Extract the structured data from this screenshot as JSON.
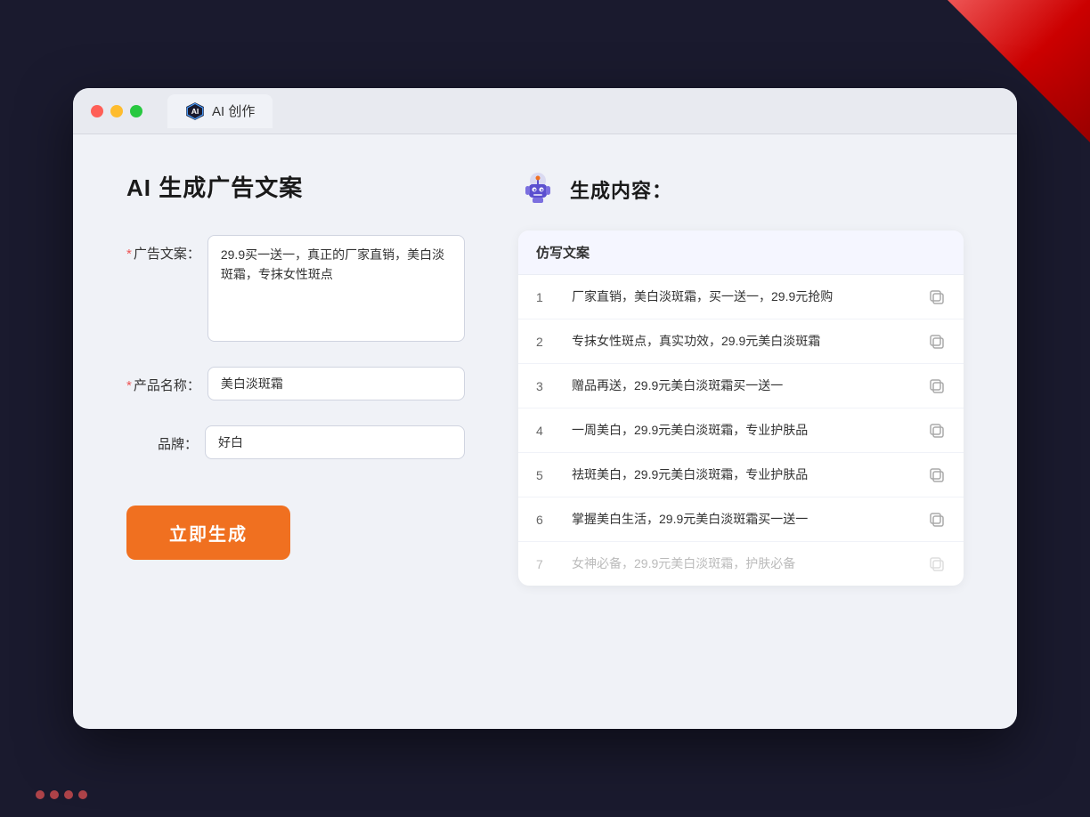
{
  "background": {
    "color": "#1a1a2e"
  },
  "browser": {
    "tab_label": "AI 创作",
    "tab_icon": "ai-icon"
  },
  "left_panel": {
    "title": "AI 生成广告文案",
    "form": {
      "ad_copy_label": "广告文案：",
      "ad_copy_required": "*",
      "ad_copy_value": "29.9买一送一，真正的厂家直销，美白淡斑霜，专抹女性斑点",
      "product_name_label": "产品名称：",
      "product_name_required": "*",
      "product_name_value": "美白淡斑霜",
      "brand_label": "品牌：",
      "brand_value": "好白",
      "generate_btn": "立即生成"
    }
  },
  "right_panel": {
    "title": "生成内容：",
    "table_header": "仿写文案",
    "results": [
      {
        "num": "1",
        "text": "厂家直销，美白淡斑霜，买一送一，29.9元抢购",
        "faded": false
      },
      {
        "num": "2",
        "text": "专抹女性斑点，真实功效，29.9元美白淡斑霜",
        "faded": false
      },
      {
        "num": "3",
        "text": "赠品再送，29.9元美白淡斑霜买一送一",
        "faded": false
      },
      {
        "num": "4",
        "text": "一周美白，29.9元美白淡斑霜，专业护肤品",
        "faded": false
      },
      {
        "num": "5",
        "text": "祛斑美白，29.9元美白淡斑霜，专业护肤品",
        "faded": false
      },
      {
        "num": "6",
        "text": "掌握美白生活，29.9元美白淡斑霜买一送一",
        "faded": false
      },
      {
        "num": "7",
        "text": "女神必备，29.9元美白淡斑霜，护肤必备",
        "faded": true
      }
    ]
  }
}
